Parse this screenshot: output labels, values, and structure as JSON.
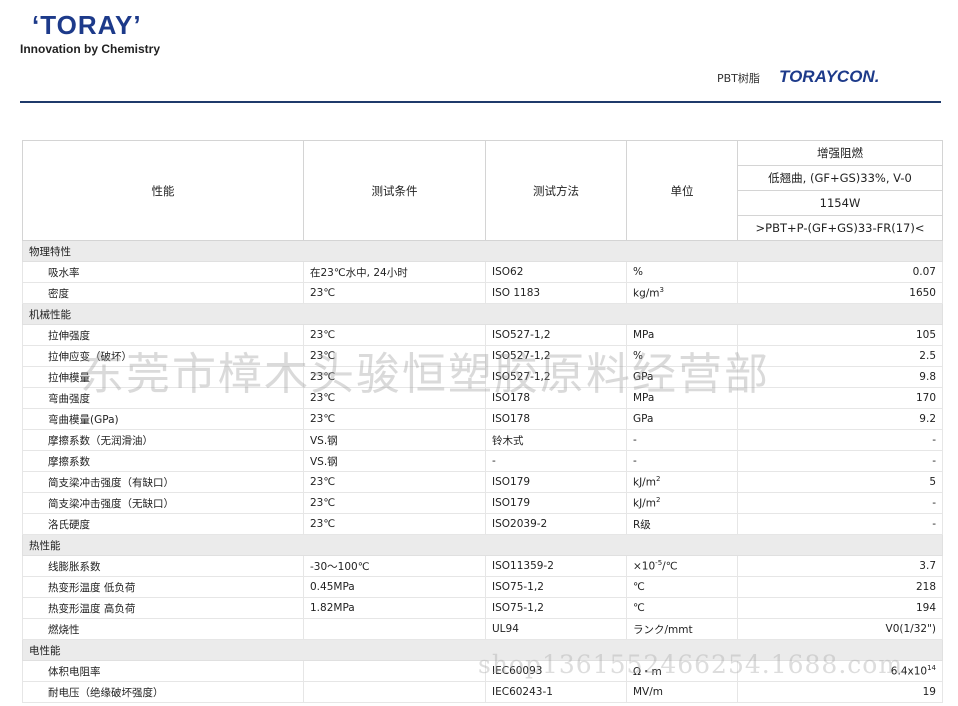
{
  "header": {
    "brand": "‘TORAY’",
    "tagline": "Innovation by Chemistry",
    "product_type": "PBT树脂",
    "product_brand": "TORAYCON."
  },
  "table": {
    "headers": {
      "property": "性能",
      "condition": "测试条件",
      "method": "测试方法",
      "unit": "单位",
      "grade_category": "增强阻燃",
      "grade_description": "低翘曲, (GF+GS)33%, V-0",
      "grade_code": "1154W",
      "grade_marking": ">PBT+P-(GF+GS)33-FR(17)<"
    },
    "sections": [
      {
        "title": "物理特性",
        "rows": [
          {
            "property": "吸水率",
            "condition": "在23℃水中, 24小时",
            "method": "ISO62",
            "unit": "%",
            "value": "0.07"
          },
          {
            "property": "密度",
            "condition": "23℃",
            "method": "ISO 1183",
            "unit": "kg/m",
            "unit_sup": "3",
            "value": "1650"
          }
        ]
      },
      {
        "title": "机械性能",
        "rows": [
          {
            "property": "拉伸强度",
            "condition": "23℃",
            "method": "ISO527-1,2",
            "unit": "MPa",
            "value": "105"
          },
          {
            "property": "拉伸应变（破坏）",
            "condition": "23℃",
            "method": "ISO527-1,2",
            "unit": "%",
            "value": "2.5"
          },
          {
            "property": "拉伸模量",
            "condition": "23℃",
            "method": "ISO527-1,2",
            "unit": "GPa",
            "value": "9.8"
          },
          {
            "property": "弯曲强度",
            "condition": "23℃",
            "method": "ISO178",
            "unit": "MPa",
            "value": "170"
          },
          {
            "property": "弯曲模量(GPa)",
            "condition": "23℃",
            "method": "ISO178",
            "unit": "GPa",
            "value": "9.2"
          },
          {
            "property": "摩擦系数（无润滑油）",
            "condition": "VS.钢",
            "method": "铃木式",
            "unit": "-",
            "value": "-"
          },
          {
            "property": "摩擦系数",
            "condition": "VS.钢",
            "method": "-",
            "unit": "-",
            "value": "-"
          },
          {
            "property": "简支梁冲击强度（有缺口）",
            "condition": "23℃",
            "method": "ISO179",
            "unit": "kJ/m",
            "unit_sup": "2",
            "value": "5"
          },
          {
            "property": "简支梁冲击强度（无缺口）",
            "condition": "23℃",
            "method": "ISO179",
            "unit": "kJ/m",
            "unit_sup": "2",
            "value": "-"
          },
          {
            "property": "洛氏硬度",
            "condition": "23℃",
            "method": "ISO2039-2",
            "unit": "R级",
            "value": "-"
          }
        ]
      },
      {
        "title": "热性能",
        "rows": [
          {
            "property": "线膨胀系数",
            "condition": "-30～100℃",
            "method": "ISO11359-2",
            "unit": "×10",
            "unit_sup": "-5",
            "unit_suffix": "/℃",
            "value": "3.7"
          },
          {
            "property": "热变形温度 低负荷",
            "condition": "0.45MPa",
            "method": "ISO75-1,2",
            "unit": "℃",
            "value": "218"
          },
          {
            "property": "热变形温度 高负荷",
            "condition": "1.82MPa",
            "method": "ISO75-1,2",
            "unit": "℃",
            "value": "194"
          },
          {
            "property": "燃烧性",
            "condition": "",
            "method": "UL94",
            "unit": "ランク/mmt",
            "value": "V0(1/32\")"
          }
        ]
      },
      {
        "title": "电性能",
        "rows": [
          {
            "property": "体积电阻率",
            "condition": "",
            "method": "IEC60093",
            "unit": "Ω・m",
            "value": "6.4x10",
            "value_sup": "14"
          },
          {
            "property": "耐电压（绝缘破坏强度）",
            "condition": "",
            "method": "IEC60243-1",
            "unit": "MV/m",
            "value": "19"
          }
        ]
      }
    ]
  },
  "watermark": {
    "main": "东莞市樟木头骏恒塑胶原料经营部",
    "url": "shop1361552466254.1688.com"
  }
}
